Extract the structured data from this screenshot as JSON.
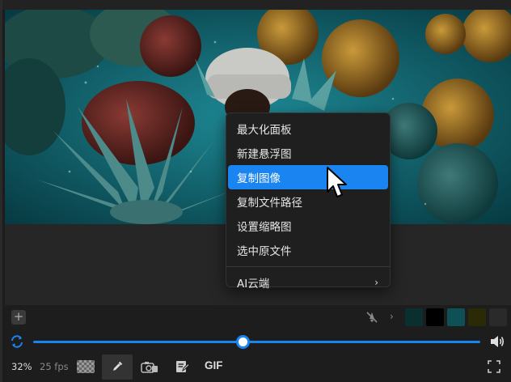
{
  "preview": {
    "description_icon": "image-preview"
  },
  "context_menu": {
    "items": [
      {
        "label": "最大化面板",
        "active": false
      },
      {
        "label": "新建悬浮图",
        "active": false
      },
      {
        "label": "复制图像",
        "active": true
      },
      {
        "label": "复制文件路径",
        "active": false
      },
      {
        "label": "设置缩略图",
        "active": false
      },
      {
        "label": "选中原文件",
        "active": false
      }
    ],
    "submenu": {
      "label": "AI云端",
      "icon": "chevron-right-icon"
    }
  },
  "toolbar": {
    "add_label": "+",
    "chevron": "›",
    "swatches": [
      "#0a2f2f",
      "#000000",
      "#0f4f56",
      "#2a2a06",
      "#2a2a2a"
    ]
  },
  "playback": {
    "progress": 0.47
  },
  "status": {
    "zoom": "32%",
    "fps": "25 fps",
    "gif_label": "GIF"
  },
  "colors": {
    "accent": "#1a84f0"
  }
}
